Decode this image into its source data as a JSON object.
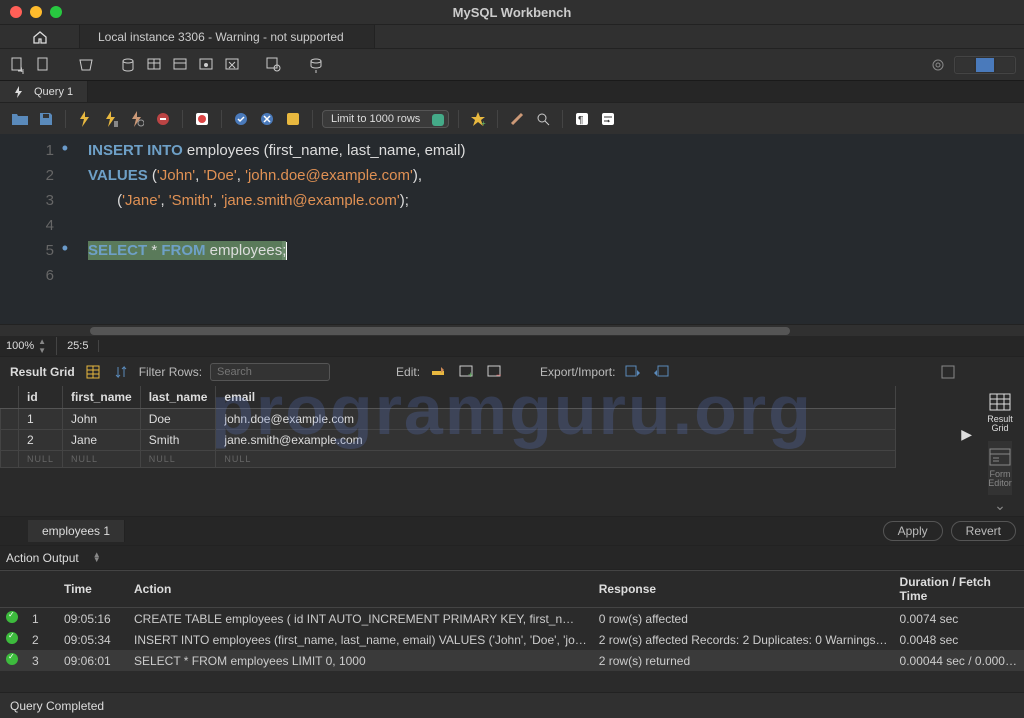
{
  "titlebar": {
    "title": "MySQL Workbench"
  },
  "main_tabs": {
    "conn": "Local instance 3306 - Warning - not supported"
  },
  "query_tab": {
    "label": "Query 1"
  },
  "limit_select": "Limit to 1000 rows",
  "editor": {
    "lines": [
      "1",
      "2",
      "3",
      "4",
      "5",
      "6"
    ],
    "kw_insert": "INSERT",
    "kw_into": " INTO",
    "ident_employees": " employees",
    "cols_open": " (",
    "col1": "first_name",
    "col_sep1": ", ",
    "col2": "last_name",
    "col_sep2": ", ",
    "col3": "email",
    "cols_close": ")",
    "kw_values": "VALUES",
    "l2_open": " (",
    "l2_s1": "'John'",
    "l2_c1": ", ",
    "l2_s2": "'Doe'",
    "l2_c2": ", ",
    "l2_s3": "'john.doe@example.com'",
    "l2_close": "),",
    "l3_open": "       (",
    "l3_s1": "'Jane'",
    "l3_c1": ", ",
    "l3_s2": "'Smith'",
    "l3_c2": ", ",
    "l3_s3": "'jane.smith@example.com'",
    "l3_close": ");",
    "kw_select": "SELECT ",
    "star": "*",
    "kw_from": " FROM",
    "ident_emp2": " employees",
    "semi": ";"
  },
  "zoom": {
    "pct": "100%",
    "pos": "25:5"
  },
  "res_toolbar": {
    "label": "Result Grid",
    "filter_label": "Filter Rows:",
    "filter_placeholder": "Search",
    "edit_label": "Edit:",
    "export_label": "Export/Import:"
  },
  "side_panel": {
    "result_grid": "Result\nGrid",
    "form_editor": "Form\nEditor"
  },
  "grid": {
    "headers": [
      "id",
      "first_name",
      "last_name",
      "email"
    ],
    "rows": [
      [
        "1",
        "John",
        "Doe",
        "john.doe@example.com"
      ],
      [
        "2",
        "Jane",
        "Smith",
        "jane.smith@example.com"
      ]
    ],
    "null_row": [
      "NULL",
      "NULL",
      "NULL",
      "NULL"
    ]
  },
  "res_tab": {
    "label": "employees 1",
    "apply": "Apply",
    "revert": "Revert"
  },
  "ao": {
    "title": "Action Output",
    "headers": [
      "",
      "",
      "Time",
      "Action",
      "Response",
      "Duration / Fetch Time"
    ],
    "rows": [
      {
        "n": "1",
        "time": "09:05:16",
        "action": "CREATE TABLE employees (     id INT AUTO_INCREMENT PRIMARY KEY,     first_n…",
        "response": "0 row(s) affected",
        "dur": "0.0074 sec"
      },
      {
        "n": "2",
        "time": "09:05:34",
        "action": "INSERT INTO employees (first_name, last_name, email) VALUES ('John', 'Doe', 'jo…",
        "response": "2 row(s) affected Records: 2  Duplicates: 0  Warnings…",
        "dur": "0.0048 sec"
      },
      {
        "n": "3",
        "time": "09:06:01",
        "action": "SELECT * FROM employees LIMIT 0, 1000",
        "response": "2 row(s) returned",
        "dur": "0.00044 sec / 0.000…"
      }
    ]
  },
  "footer": {
    "status": "Query Completed"
  },
  "watermark": "programguru.org"
}
